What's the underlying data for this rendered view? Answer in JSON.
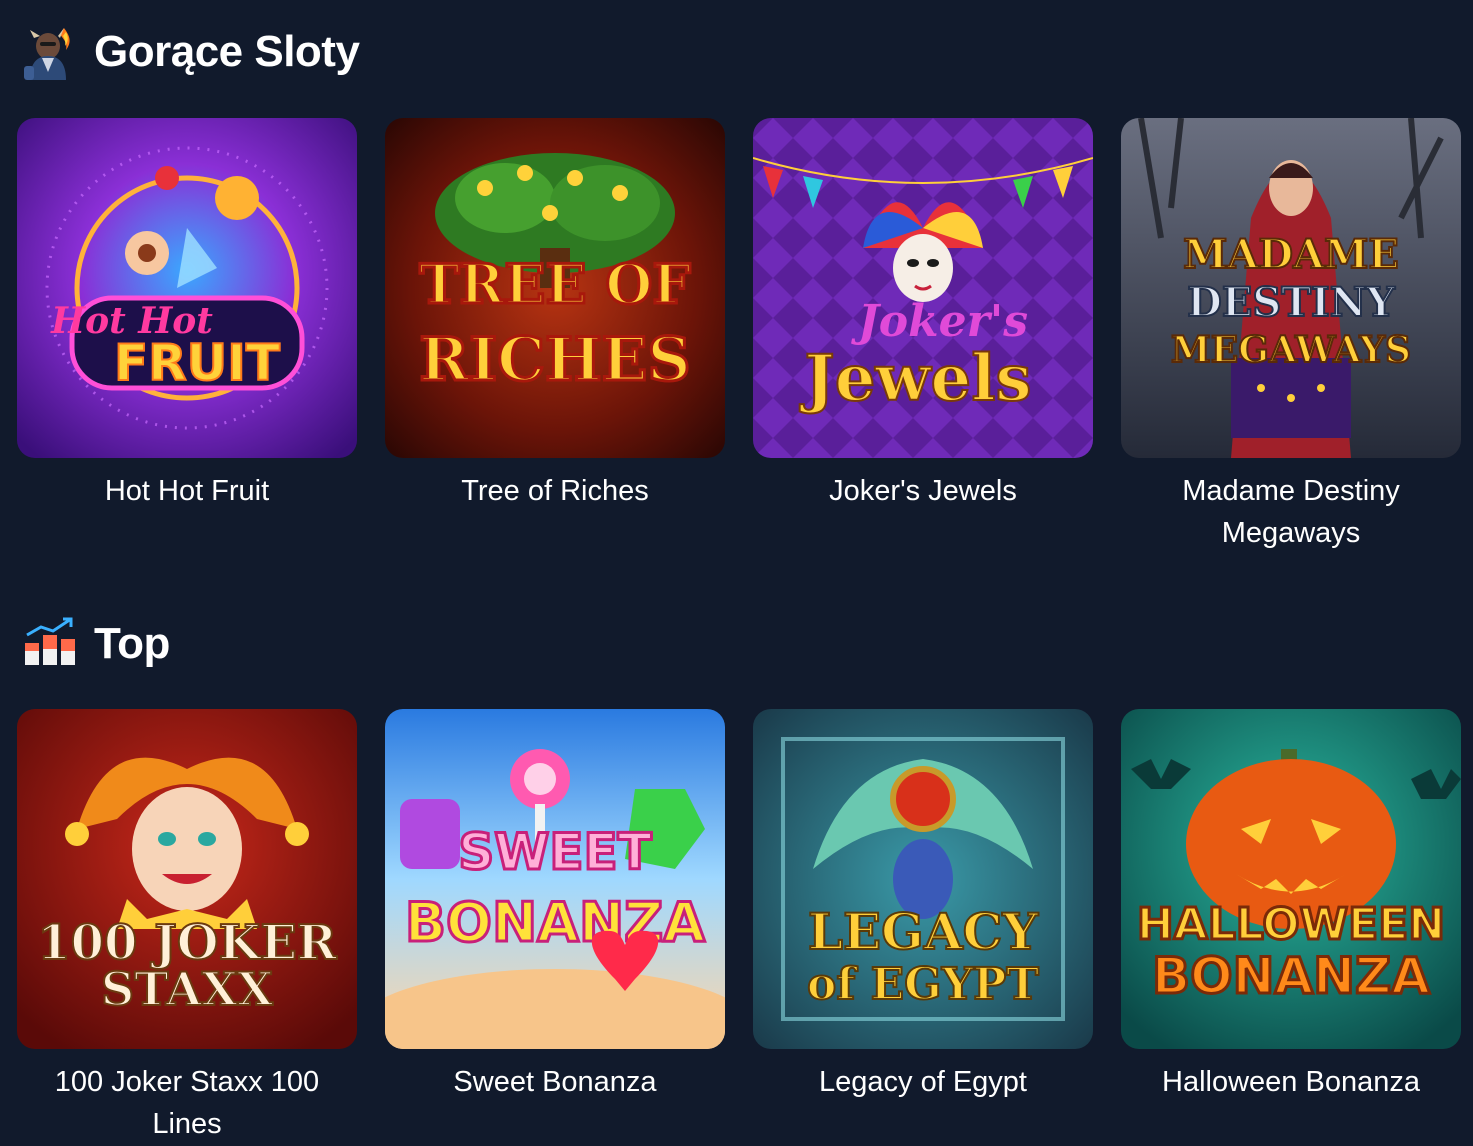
{
  "sections": [
    {
      "id": "hot",
      "title": "Gorące Sloty",
      "icon": "fire-character-icon",
      "games": [
        {
          "title": "Hot Hot Fruit",
          "art_lines": [
            "Hot Hot",
            "FRUIT"
          ]
        },
        {
          "title": "Tree of Riches",
          "art_lines": [
            "TREE OF",
            "RICHES"
          ]
        },
        {
          "title": "Joker's Jewels",
          "art_lines": [
            "Joker's",
            "Jewels"
          ]
        },
        {
          "title": "Madame Destiny Megaways",
          "art_lines": [
            "MADAME",
            "DESTINY",
            "MEGAWAYS"
          ]
        }
      ]
    },
    {
      "id": "top",
      "title": "Top",
      "icon": "trending-chart-icon",
      "games": [
        {
          "title": "100 Joker Staxx 100 Lines",
          "art_lines": [
            "100 JOKER",
            "STAXX"
          ]
        },
        {
          "title": "Sweet Bonanza",
          "art_lines": [
            "SWEET",
            "BONANZA"
          ]
        },
        {
          "title": "Legacy of Egypt",
          "art_lines": [
            "LEGACY",
            "of EGYPT"
          ]
        },
        {
          "title": "Halloween Bonanza",
          "art_lines": [
            "HALLOWEEN",
            "BONANZA"
          ]
        }
      ]
    }
  ],
  "colors": {
    "background": "#111a2c",
    "text": "#ffffff"
  }
}
